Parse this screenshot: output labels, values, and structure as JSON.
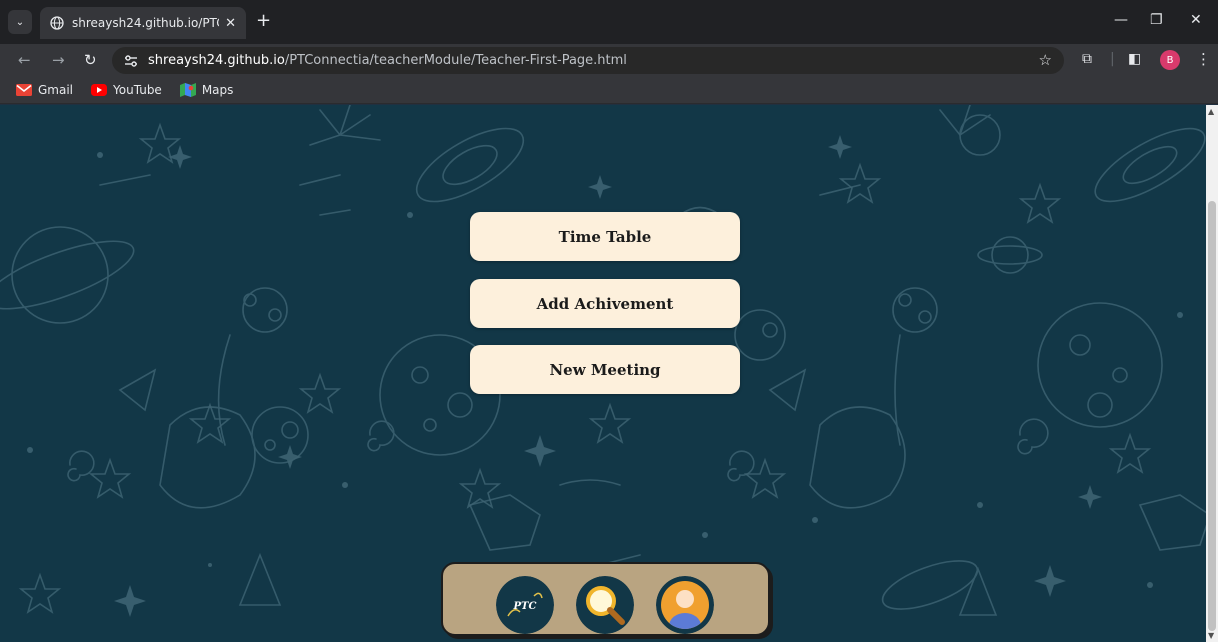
{
  "browser": {
    "tab_title": "shreaysh24.github.io/PTConnec",
    "url_host": "shreaysh24.github.io",
    "url_path": "/PTConnectia/teacherModule/Teacher-First-Page.html",
    "profile_initial": "B",
    "bookmarks": [
      {
        "label": "Gmail",
        "icon": "gmail-icon"
      },
      {
        "label": "YouTube",
        "icon": "youtube-icon"
      },
      {
        "label": "Maps",
        "icon": "maps-icon"
      }
    ]
  },
  "page": {
    "menu": [
      {
        "label": "Time Table"
      },
      {
        "label": "Add Achivement"
      },
      {
        "label": "New Meeting"
      }
    ],
    "dock": {
      "logo_text": "PTC",
      "items": [
        {
          "icon": "ptc-logo-icon"
        },
        {
          "icon": "magnifier-icon"
        },
        {
          "icon": "user-avatar-icon"
        }
      ]
    },
    "colors": {
      "background": "#123747",
      "button": "#fdf0dc",
      "dock": "#b9a481"
    }
  }
}
